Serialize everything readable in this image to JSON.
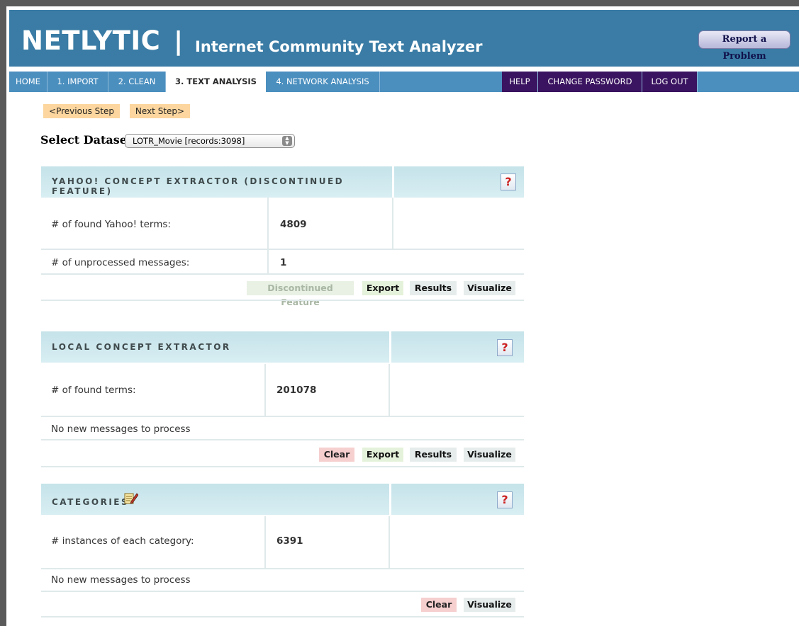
{
  "header": {
    "brand": "NETLYTIC",
    "separator": "|",
    "subtitle": "Internet Community Text Analyzer",
    "report_button": "Report a Problem"
  },
  "nav": {
    "home": "HOME",
    "import": "1. IMPORT",
    "clean": "2. CLEAN",
    "text_analysis": "3. TEXT ANALYSIS",
    "network_analysis": "4. NETWORK ANALYSIS",
    "help": "HELP",
    "change_password": "CHANGE PASSWORD",
    "logout": "LOG OUT"
  },
  "steps": {
    "previous": "<Previous Step",
    "next": "Next Step>"
  },
  "dataset": {
    "label": "Select Dataset:",
    "selected": "LOTR_Movie [records:3098]"
  },
  "yahoo": {
    "title": "YAHOO! CONCEPT EXTRACTOR (DISCONTINUED FEATURE)",
    "help": "?",
    "found_label": "# of found Yahoo! terms:",
    "found_value": "4809",
    "unprocessed_label": "# of unprocessed messages:",
    "unprocessed_value": "1",
    "actions": {
      "discontinued": "Discontinued Feature",
      "export": "Export",
      "results": "Results",
      "visualize": "Visualize"
    }
  },
  "local": {
    "title": "LOCAL CONCEPT EXTRACTOR",
    "help": "?",
    "found_label": "# of found terms:",
    "found_value": "201078",
    "status": "No new messages to process",
    "actions": {
      "clear": "Clear",
      "export": "Export",
      "results": "Results",
      "visualize": "Visualize"
    }
  },
  "categories": {
    "title": "CATEGORIES",
    "edit_icon": "edit-icon",
    "help": "?",
    "instances_label": "# instances of each category:",
    "instances_value": "6391",
    "status": "No new messages to process",
    "actions": {
      "clear": "Clear",
      "visualize": "Visualize"
    }
  },
  "colors": {
    "header_bg": "#3a7ca5",
    "nav_bg": "#4b8fbf",
    "nav_dark": "#3a1460",
    "step_btn": "#fcd69e",
    "panel_head": "#c5e3ea",
    "help_q": "#cc1f1f"
  }
}
